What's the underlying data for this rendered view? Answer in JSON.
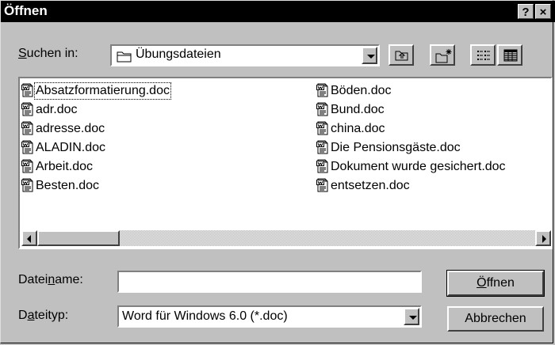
{
  "dialog": {
    "title": "Öffnen",
    "help_button": "?",
    "close_button": "×"
  },
  "lookin": {
    "label_prefix": "",
    "label_mnemonic": "S",
    "label_rest": "uchen in:",
    "value": "Übungsdateien"
  },
  "files": {
    "column1": [
      "Absatzformatierung.doc",
      "adr.doc",
      "adresse.doc",
      "ALADIN.doc",
      "Arbeit.doc",
      "Besten.doc"
    ],
    "column2": [
      "Böden.doc",
      "Bund.doc",
      "china.doc",
      "Die Pensionsgäste.doc",
      "Dokument  wurde gesichert.doc",
      "entsetzen.doc"
    ]
  },
  "filename": {
    "label_prefix": "Datei",
    "label_mnemonic": "n",
    "label_rest": "ame:",
    "value": ""
  },
  "filetype": {
    "label_prefix": "D",
    "label_mnemonic": "a",
    "label_rest": "teityp:",
    "value": "Word für Windows 6.0 (*.doc)"
  },
  "buttons": {
    "open_mnemonic": "Ö",
    "open_rest": "ffnen",
    "cancel": "Abbrechen"
  }
}
